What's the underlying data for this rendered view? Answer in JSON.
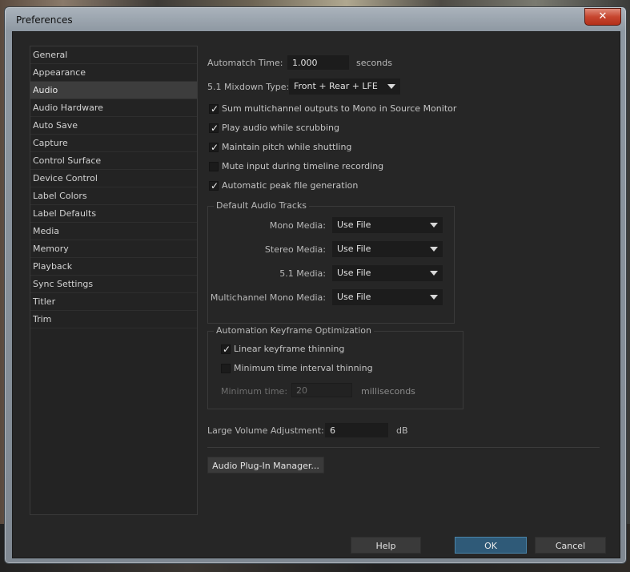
{
  "window": {
    "title": "Preferences",
    "close_glyph": "✕"
  },
  "sidebar": {
    "items": [
      {
        "label": "General"
      },
      {
        "label": "Appearance"
      },
      {
        "label": "Audio"
      },
      {
        "label": "Audio Hardware"
      },
      {
        "label": "Auto Save"
      },
      {
        "label": "Capture"
      },
      {
        "label": "Control Surface"
      },
      {
        "label": "Device Control"
      },
      {
        "label": "Label Colors"
      },
      {
        "label": "Label Defaults"
      },
      {
        "label": "Media"
      },
      {
        "label": "Memory"
      },
      {
        "label": "Playback"
      },
      {
        "label": "Sync Settings"
      },
      {
        "label": "Titler"
      },
      {
        "label": "Trim"
      }
    ],
    "selected": "Audio"
  },
  "audio": {
    "automatch_label": "Automatch Time:",
    "automatch_value": "1.000",
    "automatch_unit": "seconds",
    "mixdown_label": "5.1 Mixdown Type:",
    "mixdown_value": "Front + Rear + LFE",
    "checks": [
      {
        "label": "Sum multichannel outputs to Mono in Source Monitor",
        "checked": true
      },
      {
        "label": "Play audio while scrubbing",
        "checked": true
      },
      {
        "label": "Maintain pitch while shuttling",
        "checked": true
      },
      {
        "label": "Mute input during timeline recording",
        "checked": false
      },
      {
        "label": "Automatic peak file generation",
        "checked": true
      }
    ],
    "default_tracks": {
      "title": "Default Audio Tracks",
      "rows": [
        {
          "label": "Mono Media:",
          "value": "Use File"
        },
        {
          "label": "Stereo Media:",
          "value": "Use File"
        },
        {
          "label": "5.1 Media:",
          "value": "Use File"
        },
        {
          "label": "Multichannel Mono Media:",
          "value": "Use File"
        }
      ]
    },
    "keyframe_opt": {
      "title": "Automation Keyframe Optimization",
      "linear_label": "Linear keyframe thinning",
      "linear_checked": true,
      "min_interval_label": "Minimum time interval thinning",
      "min_interval_checked": false,
      "min_time_label": "Minimum time:",
      "min_time_value": "20",
      "min_time_unit": "milliseconds"
    },
    "large_volume_label": "Large Volume Adjustment:",
    "large_volume_value": "6",
    "large_volume_unit": "dB",
    "plugin_manager_label": "Audio Plug-In Manager..."
  },
  "footer": {
    "help_label": "Help",
    "ok_label": "OK",
    "cancel_label": "Cancel"
  },
  "colors": {
    "accent_ok": "#2f5a78",
    "selected_item": "#3d3d3d",
    "panel_bg": "#262626"
  },
  "check_glyph": "✓"
}
